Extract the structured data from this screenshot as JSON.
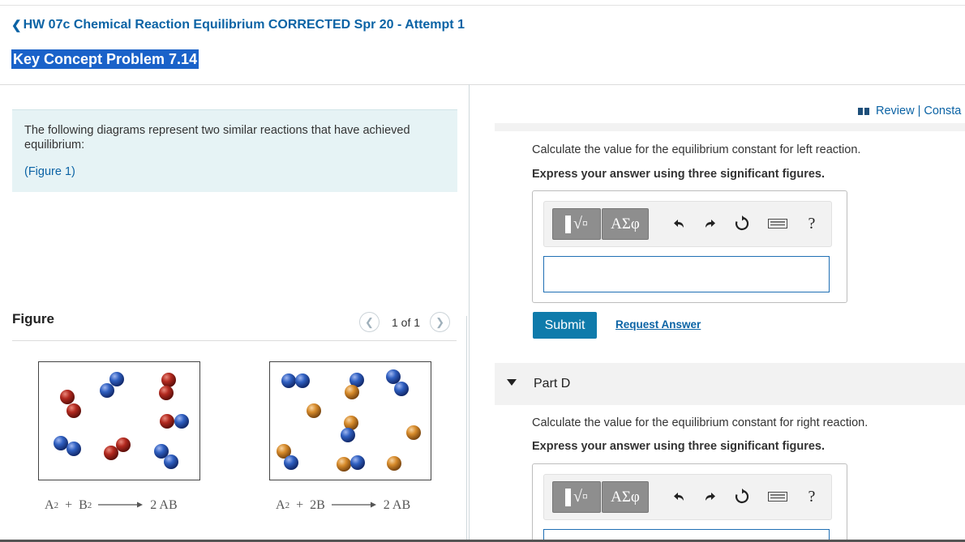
{
  "header": {
    "back_link": "HW 07c Chemical Reaction Equilibrium CORRECTED Spr 20 - Attempt 1",
    "problem_title": "Key Concept Problem 7.14"
  },
  "intro": {
    "text": "The following diagrams represent two similar reactions that have achieved equilibrium:",
    "figure_link": "(Figure 1)"
  },
  "figure": {
    "label": "Figure",
    "pager": "1 of 1",
    "left_equation": {
      "r1": "A",
      "r1_sub": "2",
      "plus": "+",
      "r2": "B",
      "r2_sub": "2",
      "product": "2 AB"
    },
    "right_equation": {
      "r1": "A",
      "r1_sub": "2",
      "plus": "+",
      "r2": "2B",
      "product": "2 AB"
    }
  },
  "review": {
    "text": "Review | Consta"
  },
  "part_c": {
    "question": "Calculate the value for the equilibrium constant for left reaction.",
    "instruction": "Express your answer using three significant figures.",
    "greek_label": "ΑΣφ",
    "help_label": "?",
    "answer_value": "",
    "submit_label": "Submit",
    "request_label": "Request Answer"
  },
  "part_d": {
    "label": "Part D",
    "question": "Calculate the value for the equilibrium constant for right reaction.",
    "instruction": "Express your answer using three significant figures.",
    "greek_label": "ΑΣφ",
    "help_label": "?"
  },
  "colors": {
    "link": "#0b63a5",
    "highlight": "#1a62c9",
    "submit": "#0f7bab",
    "intro_bg": "#e6f3f5",
    "atom_red": "#b2291f",
    "atom_blue": "#2f5fc0",
    "atom_orange": "#d68a2a"
  }
}
